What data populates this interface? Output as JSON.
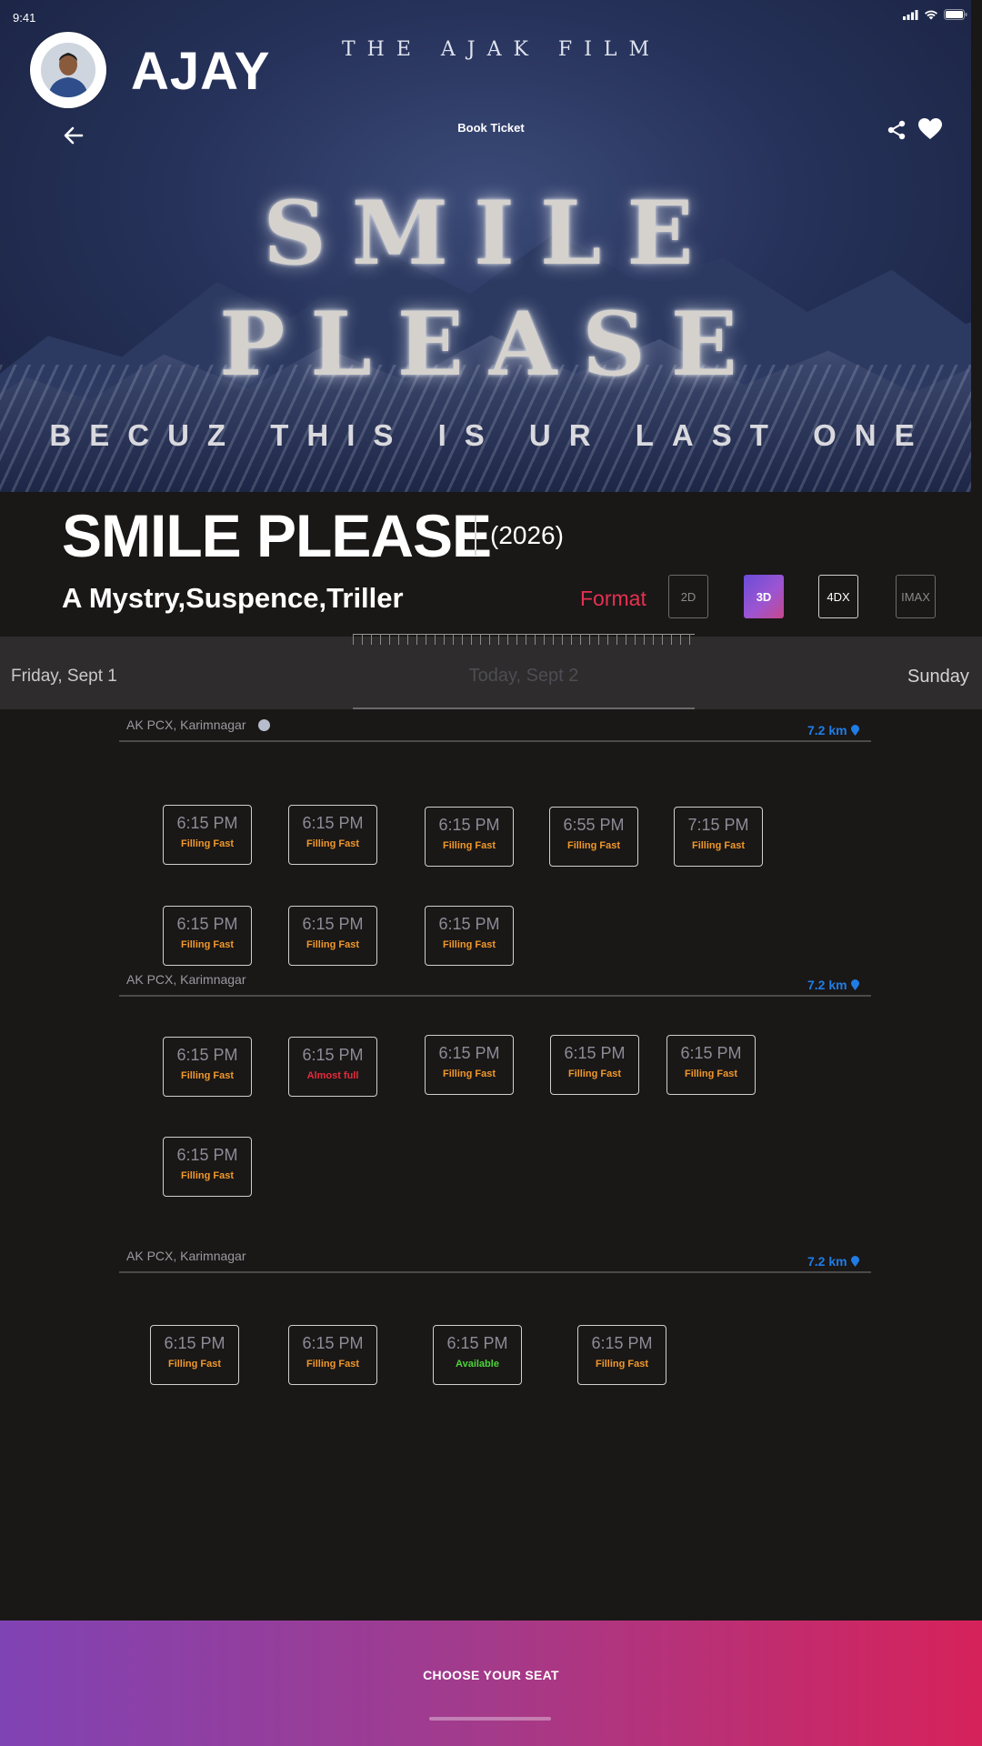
{
  "status_bar": {
    "time": "9:41"
  },
  "user": {
    "name": "AJAY"
  },
  "poster": {
    "banner": "THE AJAK FILM",
    "title_line1": "SMILE",
    "title_line2": "PLEASE",
    "tagline": "BECUZ THIS IS UR LAST ONE"
  },
  "header": {
    "title": "Book Ticket"
  },
  "movie": {
    "title": "SMILE PLEASE",
    "year": "(2026)",
    "genre": "A Mystry,Suspence,Triller"
  },
  "format": {
    "label": "Format",
    "options": [
      "2D",
      "3D",
      "4DX",
      "IMAX"
    ],
    "selected": "3D",
    "accent": "#e53150"
  },
  "dates": {
    "previous": "Friday, Sept 1",
    "current": "Today, Sept 2",
    "next": "Sunday"
  },
  "cinemas": [
    {
      "name": "AK PCX, Karimnagar",
      "distance": "7.2 km",
      "slots": [
        {
          "time": "6:15 PM",
          "status": "Filling Fast"
        },
        {
          "time": "6:15 PM",
          "status": "Filling Fast"
        },
        {
          "time": "6:15 PM",
          "status": "Filling Fast"
        },
        {
          "time": "6:55 PM",
          "status": "Filling Fast"
        },
        {
          "time": "7:15 PM",
          "status": "Filling Fast"
        },
        {
          "time": "6:15 PM",
          "status": "Filling Fast"
        },
        {
          "time": "6:15 PM",
          "status": "Filling Fast"
        },
        {
          "time": "6:15 PM",
          "status": "Filling Fast"
        }
      ]
    },
    {
      "name": "AK PCX, Karimnagar",
      "distance": "7.2 km",
      "slots": [
        {
          "time": "6:15 PM",
          "status": "Filling Fast"
        },
        {
          "time": "6:15 PM",
          "status": "Almost full"
        },
        {
          "time": "6:15 PM",
          "status": "Filling Fast"
        },
        {
          "time": "6:15 PM",
          "status": "Filling Fast"
        },
        {
          "time": "6:15 PM",
          "status": "Filling Fast"
        },
        {
          "time": "6:15 PM",
          "status": "Filling Fast"
        }
      ]
    },
    {
      "name": "AK PCX, Karimnagar",
      "distance": "7.2 km",
      "slots": [
        {
          "time": "6:15 PM",
          "status": "Filling Fast"
        },
        {
          "time": "6:15 PM",
          "status": "Filling Fast"
        },
        {
          "time": "6:15 PM",
          "status": "Available"
        },
        {
          "time": "6:15 PM",
          "status": "Filling Fast"
        }
      ]
    }
  ],
  "cta": {
    "label": "CHOOSE YOUR SEAT"
  },
  "colors": {
    "filling_fast": "#f0982a",
    "almost_full": "#e62b3c",
    "available": "#4cd33a",
    "distance": "#1f7de6"
  }
}
